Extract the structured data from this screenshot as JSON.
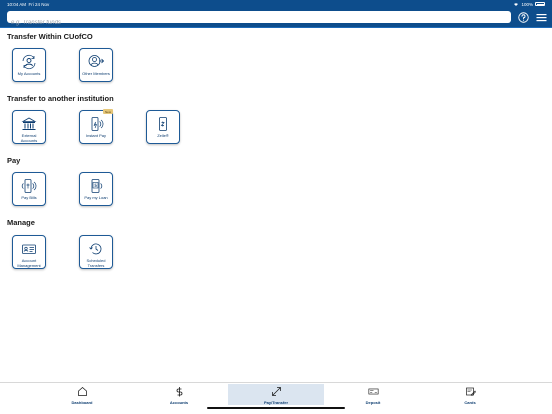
{
  "status": {
    "time": "10:04 AM",
    "date": "Fri 24 Nov",
    "battery": "100%"
  },
  "search": {
    "placeholder": "e.g. Transfer funds"
  },
  "sections": [
    {
      "title": "Transfer Within CUofCO",
      "tiles": [
        {
          "label": "My Accounts",
          "icon": "refresh-accounts-icon"
        },
        {
          "label": "Other Members",
          "icon": "person-arrow-icon"
        }
      ]
    },
    {
      "title": "Transfer to another institution",
      "tiles": [
        {
          "label": "External Accounts",
          "icon": "bank-icon"
        },
        {
          "label": "Instant Pay",
          "icon": "phone-tap-icon",
          "badge": "New"
        },
        {
          "label": "Zelle®",
          "icon": "zelle-icon"
        }
      ]
    },
    {
      "title": "Pay",
      "tiles": [
        {
          "label": "Pay Bills",
          "icon": "phone-tap-icon"
        },
        {
          "label": "Pay my Loan",
          "icon": "phone-dollar-icon"
        }
      ]
    },
    {
      "title": "Manage",
      "tiles": [
        {
          "label": "Account Management",
          "icon": "id-card-icon"
        },
        {
          "label": "Scheduled Transfers",
          "icon": "clock-history-icon"
        }
      ]
    }
  ],
  "tabs": [
    {
      "label": "Dashboard",
      "icon": "home-icon"
    },
    {
      "label": "Accounts",
      "icon": "dollar-icon"
    },
    {
      "label": "Pay/Transfer",
      "icon": "transfer-arrows-icon",
      "active": true
    },
    {
      "label": "Deposit",
      "icon": "check-deposit-icon"
    },
    {
      "label": "Cards",
      "icon": "card-icon"
    }
  ],
  "colors": {
    "header": "#0d4d8c",
    "accent": "#1e5a96",
    "active_tab": "#dbe5f0"
  }
}
